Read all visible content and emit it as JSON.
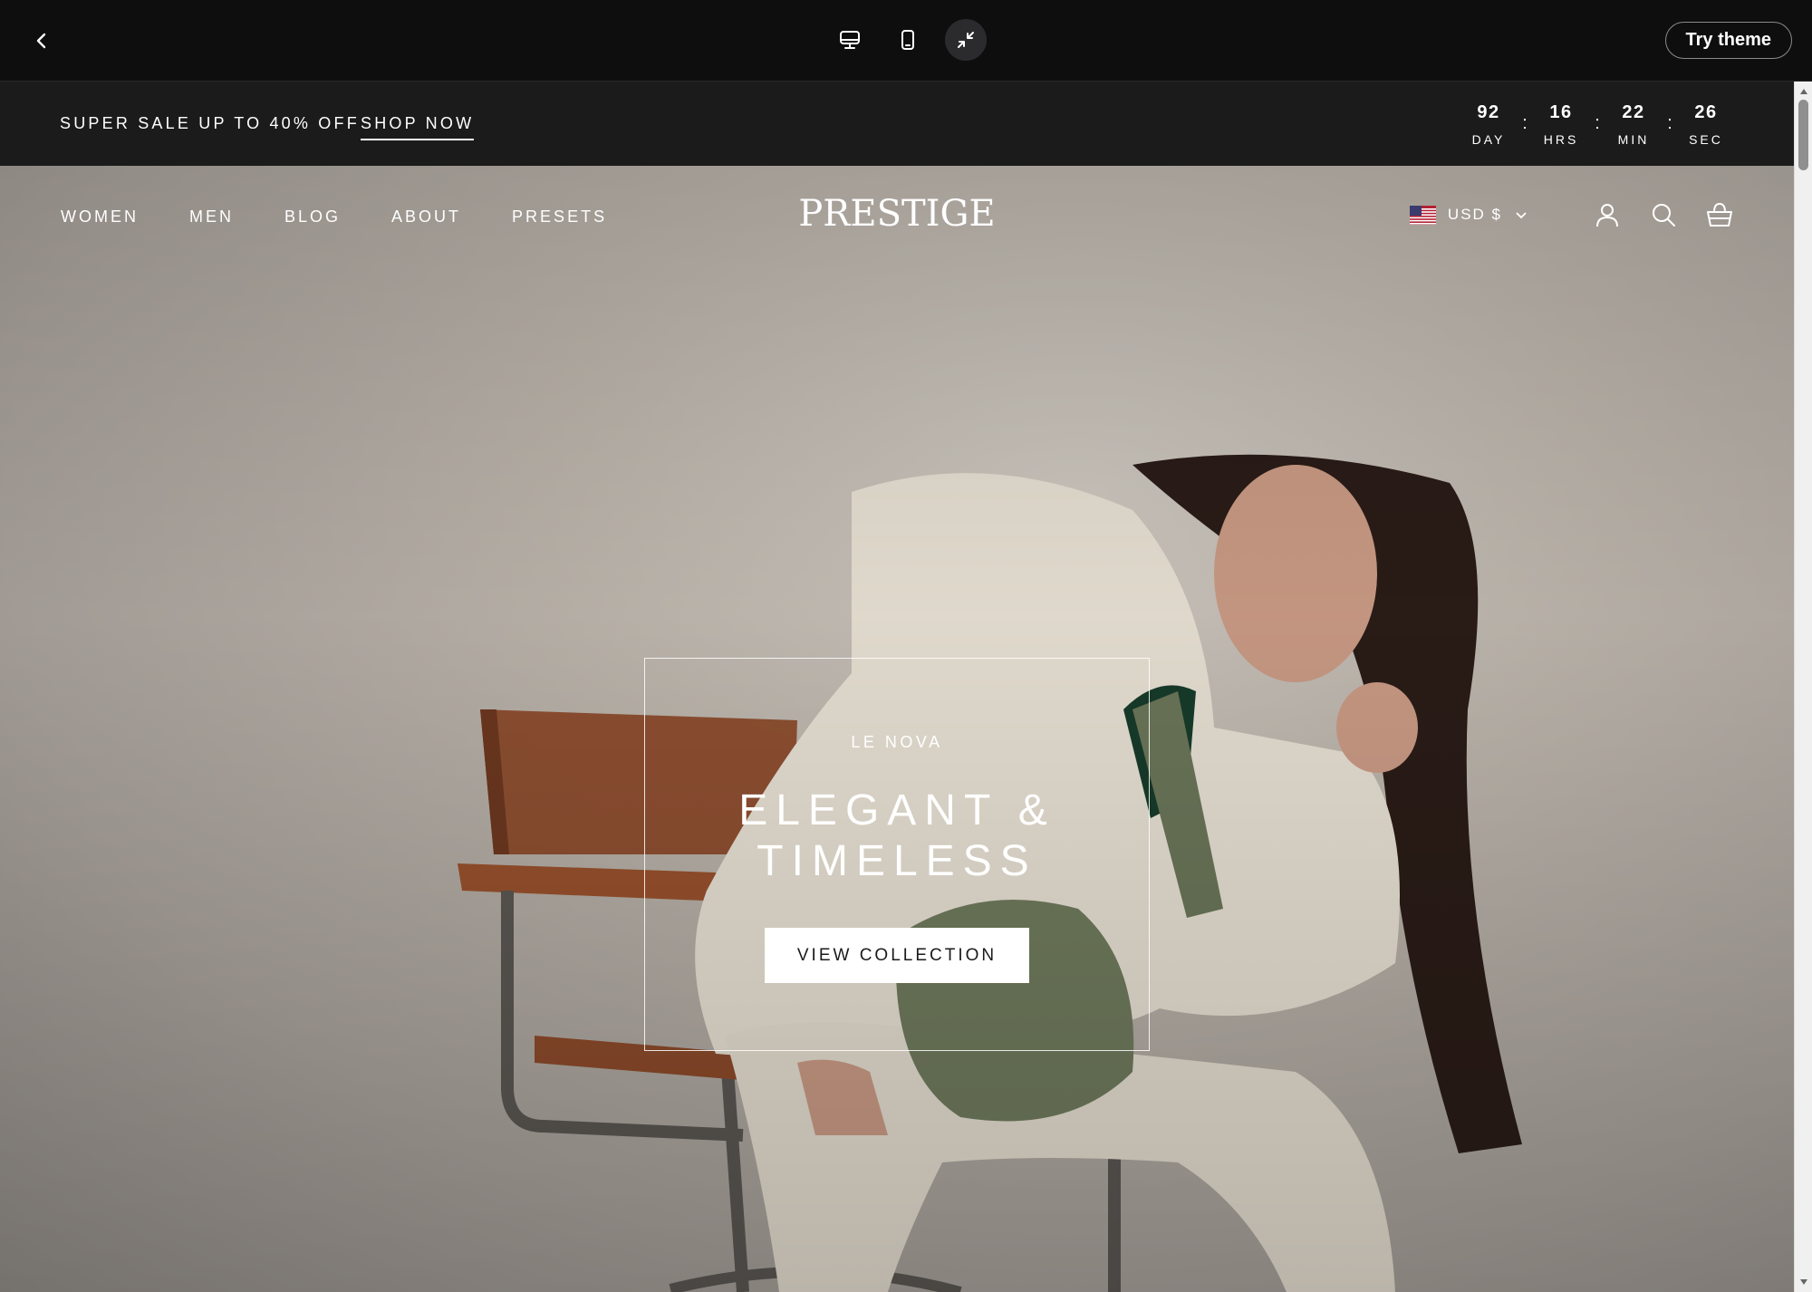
{
  "preview_bar": {
    "back_label": "Back",
    "devices": [
      "desktop",
      "mobile",
      "fullscreen"
    ],
    "try_theme_label": "Try theme"
  },
  "announcement": {
    "text": "SUPER SALE UP TO 40% OFF",
    "link": "SHOP NOW",
    "countdown": {
      "days": "92",
      "days_label": "DAY",
      "hours": "16",
      "hours_label": "HRS",
      "minutes": "22",
      "minutes_label": "MIN",
      "seconds": "26",
      "seconds_label": "SEC",
      "separator": ":"
    }
  },
  "header": {
    "nav": [
      "WOMEN",
      "MEN",
      "BLOG",
      "ABOUT",
      "PRESETS"
    ],
    "logo": "PRESTIGE",
    "currency": "USD $"
  },
  "hero": {
    "subheading": "LE NOVA",
    "title_line1": "ELEGANT &",
    "title_line2": "TIMELESS",
    "cta": "VIEW COLLECTION"
  },
  "colors": {
    "preview_bar_bg": "#0f0e0f",
    "announcement_bg": "#1b1b1b",
    "hero_bg": "#bab3aa",
    "cta_bg": "#ffffff",
    "text_light": "#ffffff"
  }
}
